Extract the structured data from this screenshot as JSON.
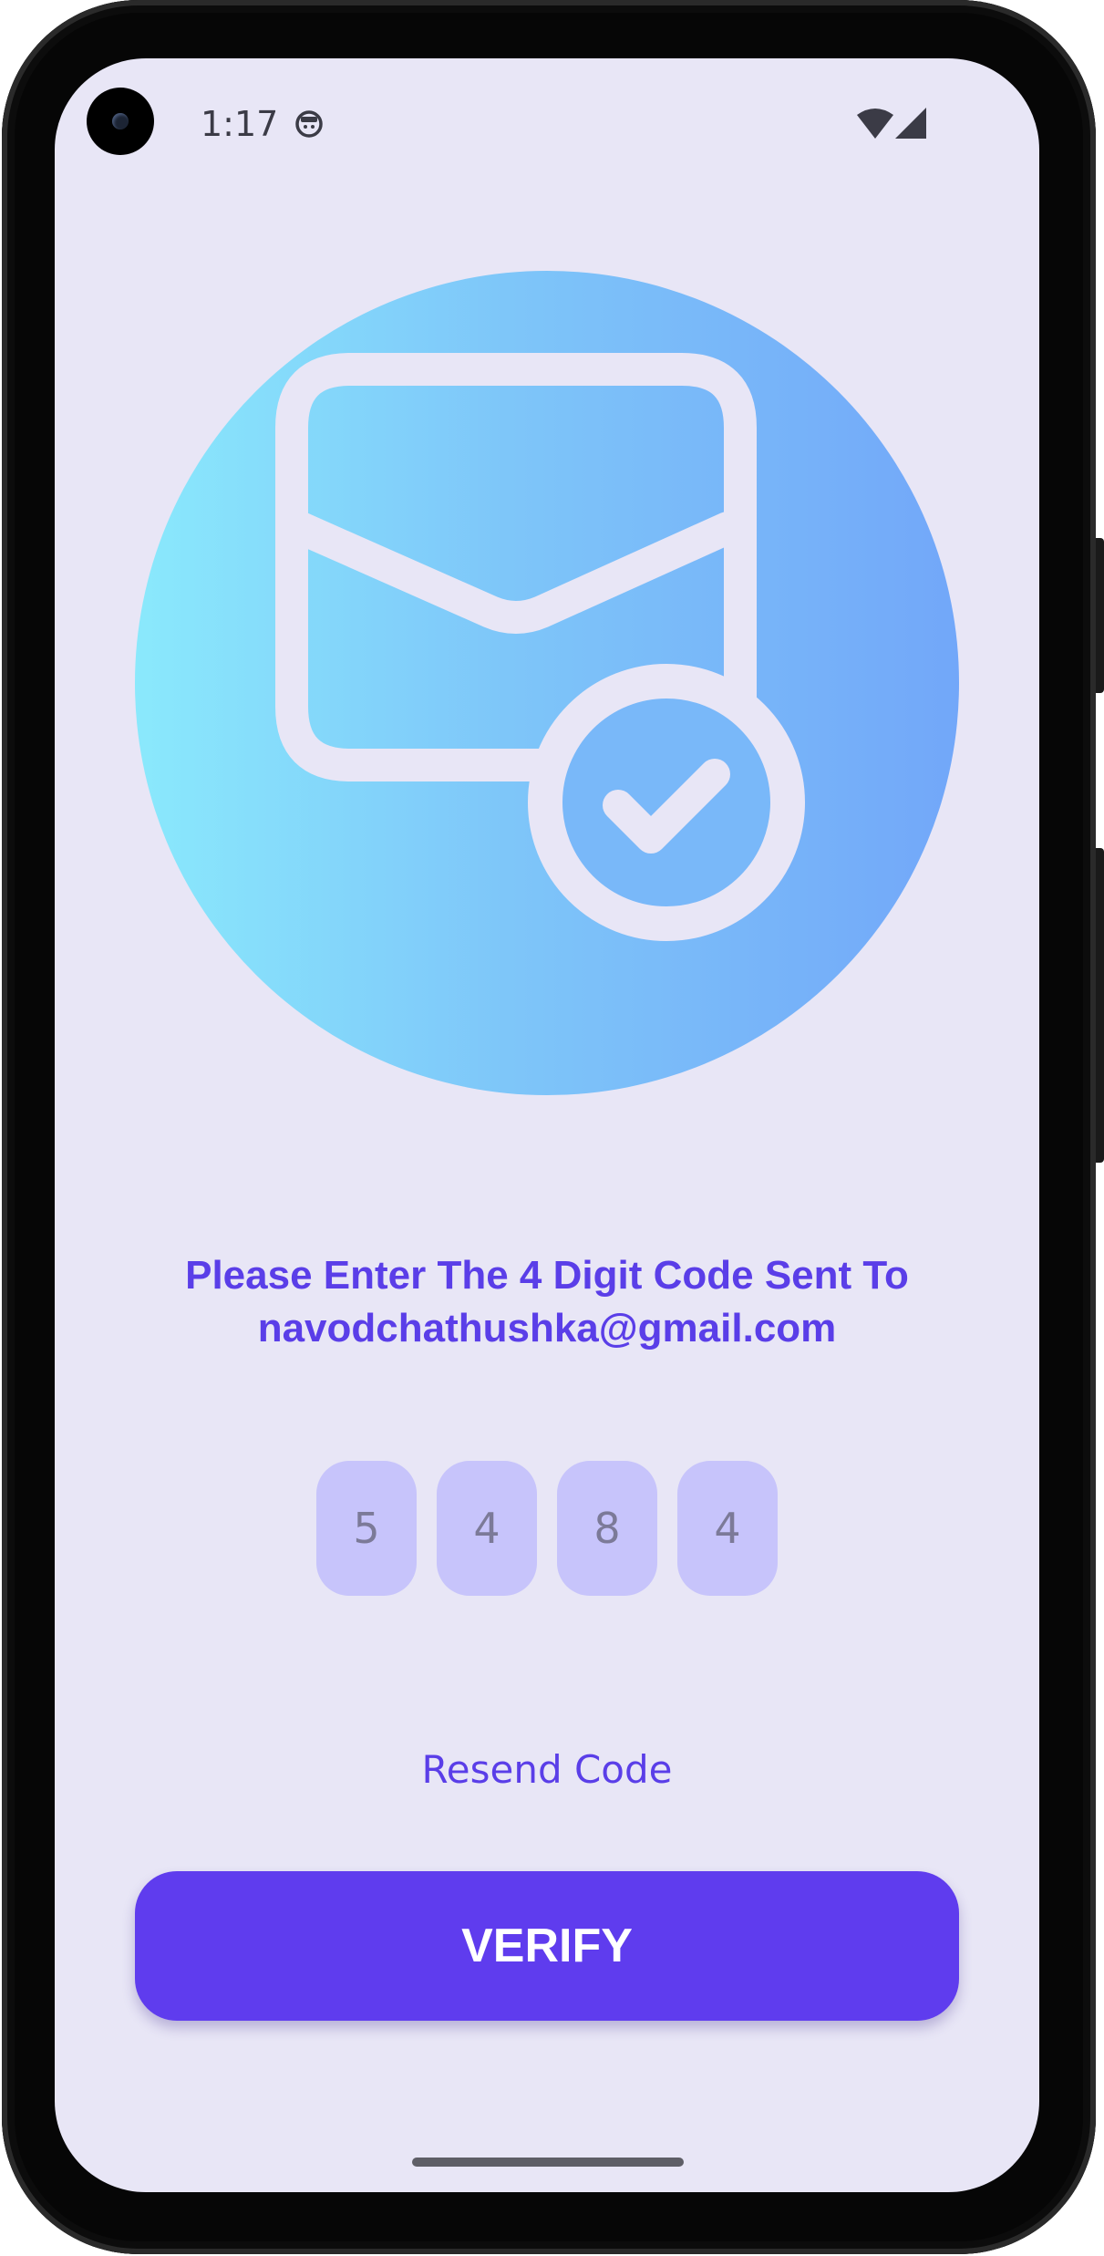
{
  "status_bar": {
    "time": "1:17",
    "app_icon": "android-debug-icon",
    "wifi_icon": "wifi-icon",
    "cell_icon": "cell-signal-icon"
  },
  "hero": {
    "icon": "mail-check-icon",
    "gradient_colors": [
      "#8ae9fc",
      "#72a7f9"
    ]
  },
  "verification": {
    "message_line1": "Please Enter The 4 Digit Code Sent To",
    "message_line2": "navodchathushka@gmail.com",
    "code_digits": [
      "5",
      "4",
      "8",
      "4"
    ],
    "resend_label": "Resend Code",
    "verify_label": "VERIFY"
  },
  "colors": {
    "accent": "#5f3cee",
    "text_accent": "#5a3ee8",
    "background": "#e8e6f6",
    "code_box": "#c7c4fb"
  }
}
